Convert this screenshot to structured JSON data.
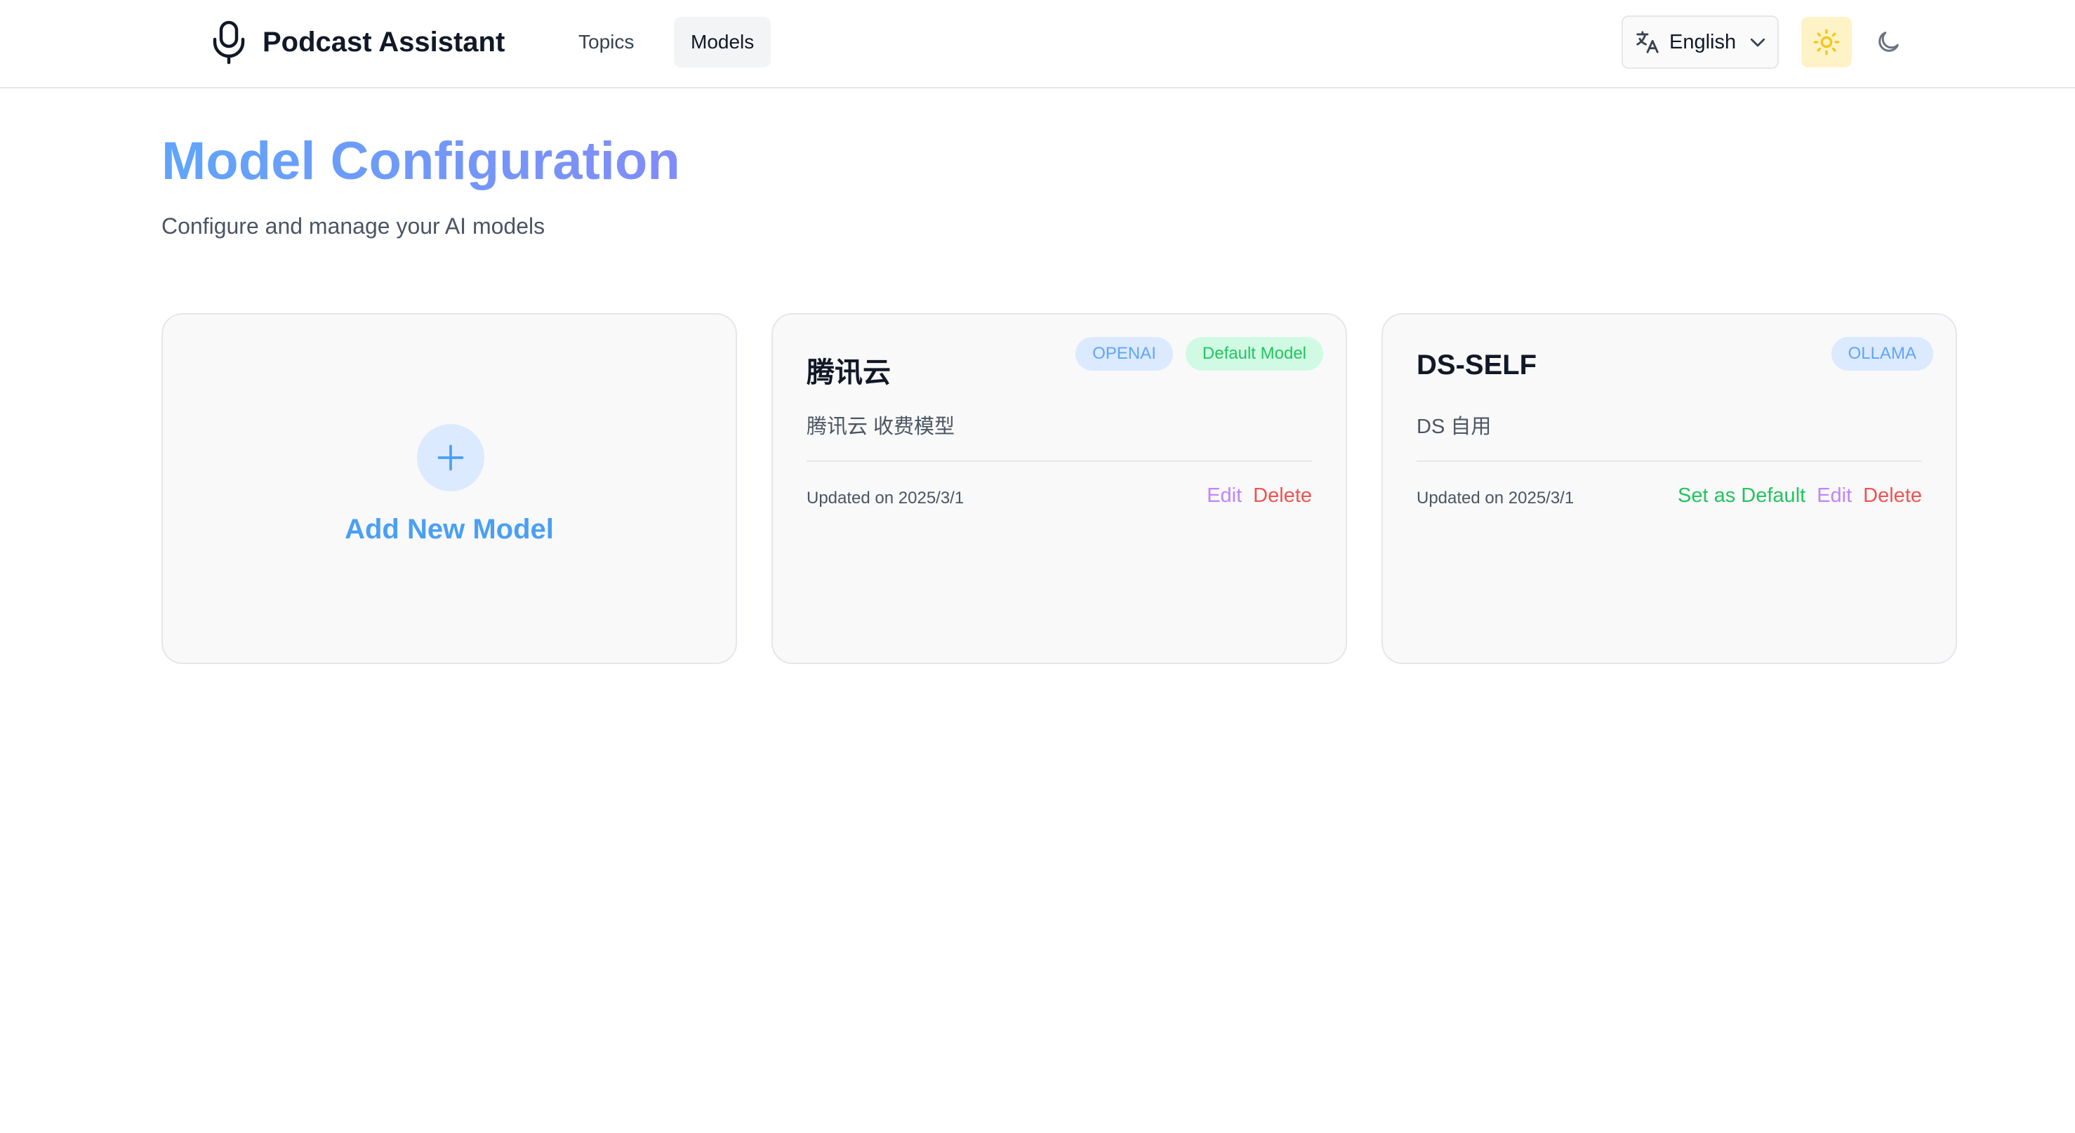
{
  "app": {
    "name": "Podcast Assistant",
    "icon": "microphone-icon"
  },
  "nav": {
    "items": [
      {
        "label": "Topics",
        "active": false
      },
      {
        "label": "Models",
        "active": true
      }
    ]
  },
  "language": {
    "icon": "translate-icon",
    "selected": "English"
  },
  "theme": {
    "options": [
      {
        "name": "light",
        "icon": "sun-icon",
        "active": true
      },
      {
        "name": "dark",
        "icon": "moon-icon",
        "active": false
      }
    ]
  },
  "page": {
    "title": "Model Configuration",
    "subtitle": "Configure and manage your AI models"
  },
  "add_card": {
    "icon": "plus-icon",
    "label": "Add New Model"
  },
  "models": [
    {
      "name": "腾讯云",
      "description": "腾讯云 收费模型",
      "provider": "OPENAI",
      "default_badge": "Default Model",
      "updated": "Updated on 2025/3/1",
      "actions": {
        "edit": "Edit",
        "delete": "Delete"
      }
    },
    {
      "name": "DS-SELF",
      "description": "DS 自用",
      "provider": "OLLAMA",
      "updated": "Updated on 2025/3/1",
      "actions": {
        "set_default": "Set as Default",
        "edit": "Edit",
        "delete": "Delete"
      }
    }
  ],
  "colors": {
    "accent_blue": "#4a9ff5",
    "title_gradient_start": "#60a5fa",
    "title_gradient_end": "#818cf8",
    "provider_badge_bg": "#dbeafe",
    "default_badge_bg": "#d1fae5",
    "success_green": "#22c55e",
    "edit_purple": "#c084fc",
    "delete_red": "#f05252",
    "sun_yellow": "#f5c518"
  }
}
